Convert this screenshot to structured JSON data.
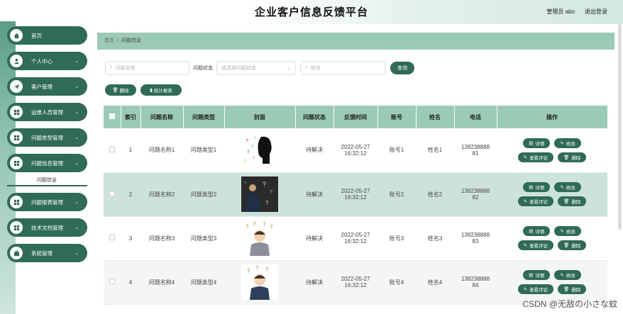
{
  "header": {
    "title": "企业客户信息反馈平台",
    "user": "管理员 abo",
    "logout": "退出登录"
  },
  "sidebar": {
    "items": [
      {
        "label": "首页",
        "icon": "home-icon",
        "arrow": ""
      },
      {
        "label": "个人中心",
        "icon": "person-icon",
        "arrow": "⌄"
      },
      {
        "label": "客户管理",
        "icon": "send-icon",
        "arrow": "⌄"
      },
      {
        "label": "运维人员管理",
        "icon": "grid-icon",
        "arrow": "⌄"
      },
      {
        "label": "问题类型管理",
        "icon": "grid-icon",
        "arrow": "⌄"
      },
      {
        "label": "问题信息管理",
        "icon": "grid-icon",
        "arrow": "⌄"
      },
      {
        "label": "问题报表管理",
        "icon": "grid-icon",
        "arrow": "⌄"
      },
      {
        "label": "技术文档管理",
        "icon": "grid-icon",
        "arrow": "⌄"
      },
      {
        "label": "系统管理",
        "icon": "briefcase-icon",
        "arrow": "⌄"
      }
    ],
    "sub_item": "问题信息"
  },
  "breadcrumb": {
    "home": "首页",
    "sep": "/",
    "current": "问题信息"
  },
  "filters": {
    "name_placeholder": "问题名称",
    "status_label": "问题状态",
    "status_placeholder": "请选择问题状态",
    "account_placeholder": "姓名",
    "query_button": "查询"
  },
  "actions": {
    "delete": "删除",
    "report": "统计报表"
  },
  "table": {
    "headers": [
      "",
      "索引",
      "问题名称",
      "问题类型",
      "封面",
      "问题状态",
      "反馈时间",
      "账号",
      "姓名",
      "电话",
      "操作"
    ],
    "rows": [
      {
        "index": "1",
        "name": "问题名称1",
        "type": "问题类型1",
        "status": "待解决",
        "date": "2022-05-27",
        "time": "16:32:12",
        "account": "账号1",
        "person": "姓名1",
        "phone1": "138238888",
        "phone2": "81"
      },
      {
        "index": "2",
        "name": "问题名称2",
        "type": "问题类型2",
        "status": "待解决",
        "date": "2022-05-27",
        "time": "16:32:12",
        "account": "账号2",
        "person": "姓名2",
        "phone1": "138238888",
        "phone2": "82"
      },
      {
        "index": "3",
        "name": "问题名称3",
        "type": "问题类型3",
        "status": "待解决",
        "date": "2022-05-27",
        "time": "16:32:12",
        "account": "账号3",
        "person": "姓名3",
        "phone1": "138238888",
        "phone2": "83"
      },
      {
        "index": "4",
        "name": "问题名称4",
        "type": "问题类型4",
        "status": "待解决",
        "date": "2022-05-27",
        "time": "16:32:12",
        "account": "账号4",
        "person": "姓名4",
        "phone1": "138238888",
        "phone2": "84"
      }
    ],
    "op_labels": {
      "detail": "详情",
      "edit": "修改",
      "comments": "查看评论",
      "delete": "删除"
    }
  },
  "watermark": "CSDN @无敌の小さな蚊",
  "colors": {
    "primary": "#2f6b57",
    "header_row": "#9bcab5",
    "alt_row": "#cde3d9"
  }
}
